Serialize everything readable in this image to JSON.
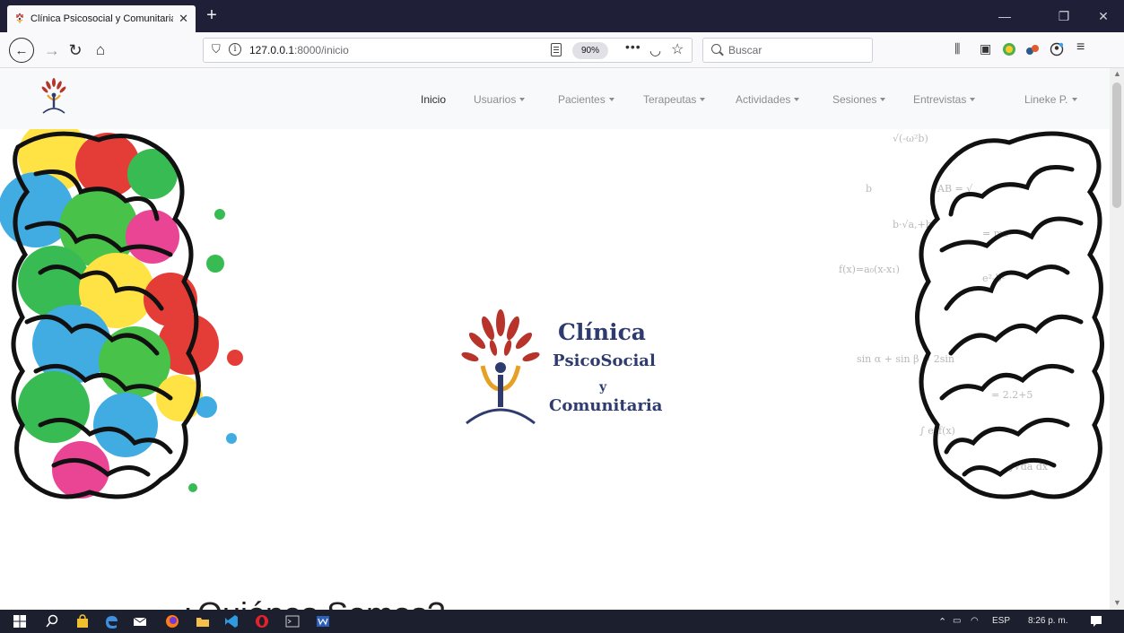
{
  "browser": {
    "tab_title": "Clínica Psicosocial y Comunitaria",
    "url_host": "127.0.0.1",
    "url_rest": ":8000/inicio",
    "zoom": "90%",
    "search_placeholder": "Buscar",
    "more_label": "•••"
  },
  "site_nav": {
    "items": [
      {
        "label": "Inicio"
      },
      {
        "label": "Usuarios"
      },
      {
        "label": "Pacientes"
      },
      {
        "label": "Terapeutas"
      },
      {
        "label": "Actividades"
      },
      {
        "label": "Sesiones"
      },
      {
        "label": "Entrevistas"
      }
    ],
    "user": "Lineke P."
  },
  "hero": {
    "brand_line1": "Clínica",
    "brand_line2": "PsicoSocial",
    "brand_line3": "y",
    "brand_line4": "Comunitaria"
  },
  "section": {
    "heading": "¿Quiénes Somos?"
  },
  "taskbar": {
    "language": "ESP",
    "time": "8:26 p. m."
  },
  "colors": {
    "brand_navy": "#2e3b6e",
    "brand_red": "#b8342a",
    "brand_orange": "#e6a024",
    "tabstrip": "#1f2038"
  }
}
